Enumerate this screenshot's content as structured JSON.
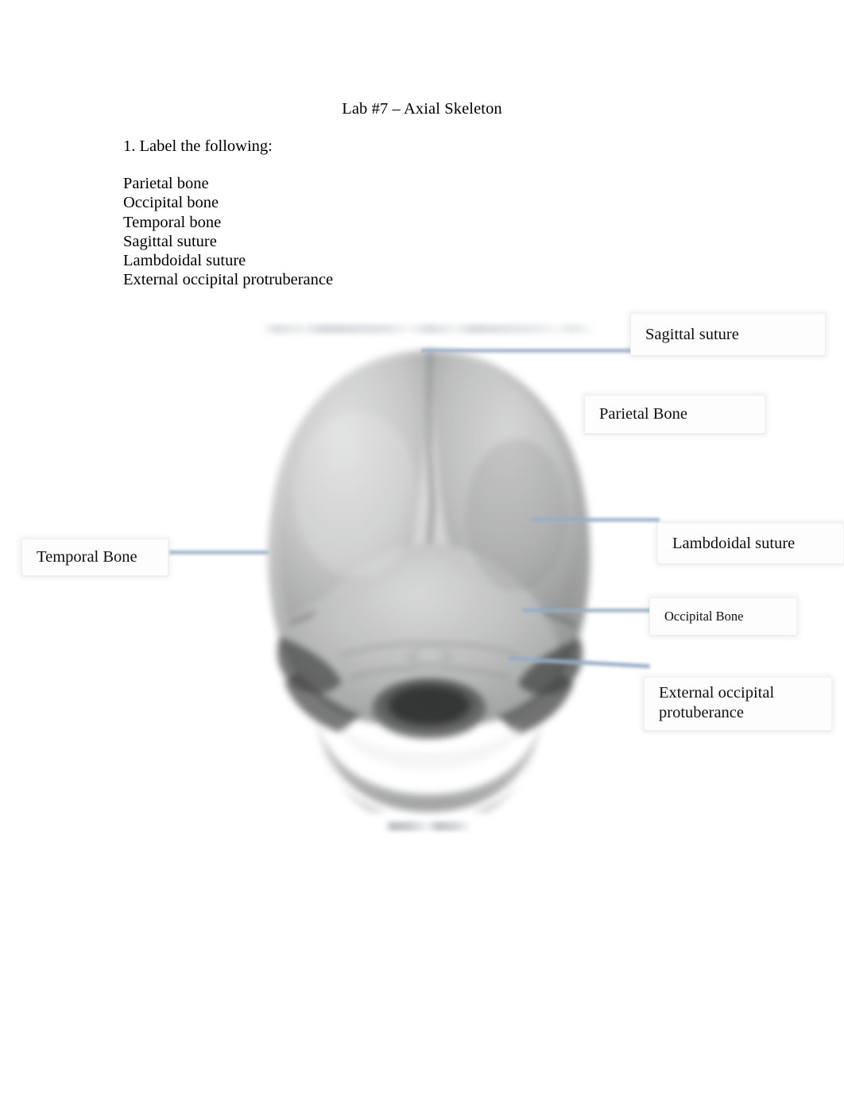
{
  "document": {
    "title": "Lab #7 – Axial Skeleton",
    "instruction": "1. Label the following:",
    "terms": [
      "Parietal bone",
      "Occipital bone",
      "Temporal bone",
      "Sagittal suture",
      "Lambdoidal suture",
      "External occipital protruberance"
    ]
  },
  "figure": {
    "description": "posterior-view-skull-diagram",
    "leader_line_color": "#8aa2bd",
    "callouts": [
      {
        "id": "sagittal",
        "label": "Sagittal suture"
      },
      {
        "id": "parietal",
        "label": "Parietal Bone"
      },
      {
        "id": "lambdoidal",
        "label": "Lambdoidal suture"
      },
      {
        "id": "occipital",
        "label": "Occipital Bone"
      },
      {
        "id": "external",
        "label": "External occipital\nprotuberance"
      },
      {
        "id": "temporal",
        "label": "Temporal Bone"
      }
    ]
  }
}
